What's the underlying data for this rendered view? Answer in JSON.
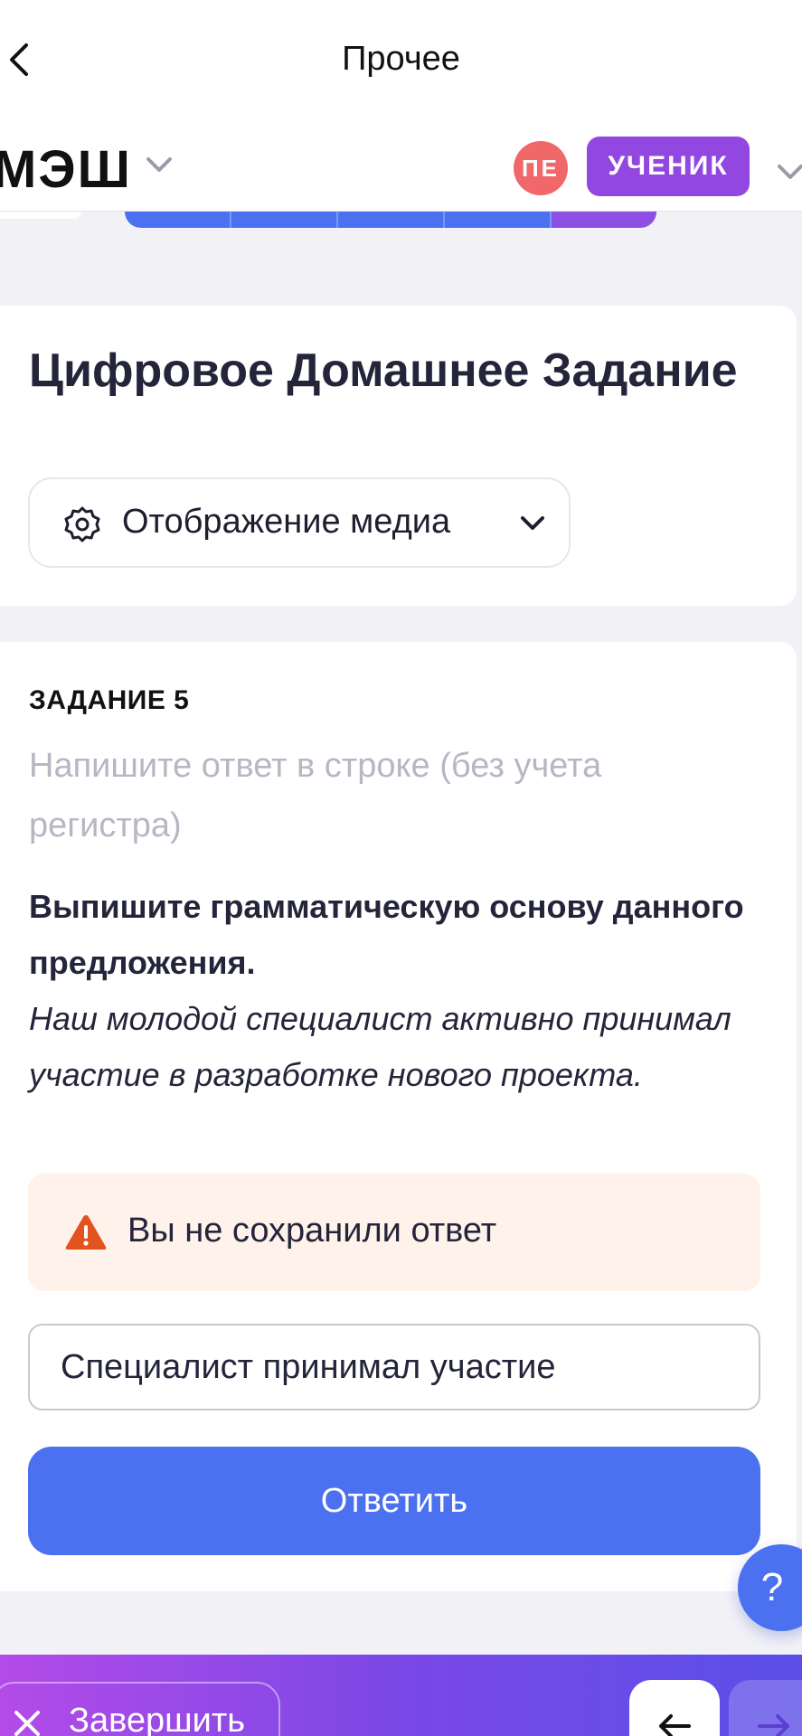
{
  "nav": {
    "title": "Прочее"
  },
  "header": {
    "logo": "МЭШ",
    "avatar_initials": "ПЕ",
    "role": "УЧЕНИК"
  },
  "homework": {
    "title": "Цифровое Домашнее Задание",
    "media_toggle_label": "Отображение медиа"
  },
  "task": {
    "label": "ЗАДАНИЕ 5",
    "hint": "Напишите ответ в строке (без учета регистра)",
    "question": "Выпишите грамматическую основу данного предложения.",
    "sentence": "Наш молодой специалист активно принимал участие в разработке нового проекта.",
    "warning": "Вы не сохранили ответ",
    "answer_value": "Специалист принимал участие",
    "submit_label": "Ответить"
  },
  "help": {
    "label": "?"
  },
  "footer": {
    "finish_label": "Завершить"
  },
  "icons": {
    "back": "chevron-left-icon",
    "logo_dropdown": "chevron-down-icon",
    "role_dropdown": "chevron-down-icon",
    "media": "gear-icon",
    "warning": "warning-triangle-icon",
    "finish": "close-icon",
    "prev": "arrow-left-icon",
    "next": "arrow-right-icon"
  },
  "colors": {
    "accent": "#4B70F0",
    "role_badge": "#9147E0",
    "avatar": "#F0686A",
    "warning_bg": "#FEF2EB",
    "warning_icon": "#E2531E"
  }
}
